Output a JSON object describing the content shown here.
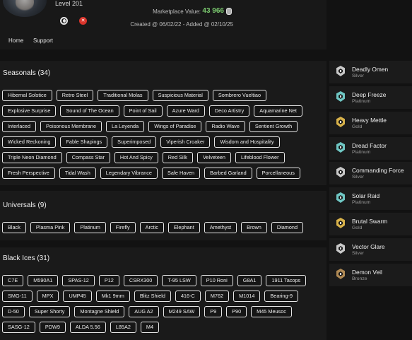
{
  "profile": {
    "level": "Level 201",
    "platform_icons": [
      "ubisoft-icon",
      "xbox-icon"
    ],
    "marketplace_label": "Marketplace Value:",
    "marketplace_value": "43 966",
    "dates": "Created @ 06/02/22 - Added @ 02/10/25"
  },
  "nav": {
    "home": "Home",
    "support": "Support"
  },
  "seasonals": {
    "title": "Seasonals (34)",
    "items": [
      "Hibernal Solstice",
      "Retro Steel",
      "Traditional Molas",
      "Suspicious Material",
      "Sombrero Vueltiao",
      "Explosive Surprise",
      "Sound of The Ocean",
      "Point of Sail",
      "Azure Ward",
      "Deco Artistry",
      "Aquamarine Net",
      "Interlaced",
      "Poisonous Membrane",
      "La Leyenda",
      "Wings of Paradise",
      "Radio Wave",
      "Sentient Growth",
      "Wicked Reckoning",
      "Fable Shapings",
      "Superimposed",
      "Viperish Croaker",
      "Wisdom and Hospitality",
      "Triple Neon Diamond",
      "Compass Star",
      "Hot And Spicy",
      "Red Silk",
      "Velveteen",
      "Lifeblood Flower",
      "Fresh Perspective",
      "Tidal Wash",
      "Legendary Vibrance",
      "Safe Haven",
      "Barbed Garland",
      "Porcellaneous"
    ]
  },
  "universals": {
    "title": "Universals (9)",
    "items": [
      "Black",
      "Plasma Pink",
      "Platinum",
      "Firefly",
      "Arctic",
      "Elephant",
      "Amethyst",
      "Brown",
      "Diamond"
    ]
  },
  "black_ices": {
    "title": "Black Ices (31)",
    "items": [
      "C7E",
      "M590A1",
      "SPAS-12",
      "P12",
      "CSRX300",
      "T-95 LSW",
      "P10 Roni",
      "G8A1",
      "1911 Tacops",
      "SMG-11",
      "MPX",
      "UMP45",
      "Mk1 9mm",
      "Blitz Shield",
      "416-C",
      "M762",
      "M1014",
      "Bearing-9",
      "D-50",
      "Super Shorty",
      "Montagne Shield",
      "AUG A2",
      "M249 SAW",
      "P9",
      "P90",
      "M45 Meusoc",
      "SASG-12",
      "PDW9",
      "ALDA 5.56",
      "L85A2",
      "M4"
    ]
  },
  "ranks": [
    {
      "name": "Deadly Omen",
      "tier": "Silver",
      "color": "#c9c9c9"
    },
    {
      "name": "Deep Freeze",
      "tier": "Platinum",
      "color": "#6fc7c4"
    },
    {
      "name": "Heavy Mettle",
      "tier": "Gold",
      "color": "#d8b24a"
    },
    {
      "name": "Dread Factor",
      "tier": "Platinum",
      "color": "#6fc7c4"
    },
    {
      "name": "Commanding Force",
      "tier": "Silver",
      "color": "#c9c9c9"
    },
    {
      "name": "Solar Raid",
      "tier": "Platinum",
      "color": "#6fc7c4"
    },
    {
      "name": "Brutal Swarm",
      "tier": "Gold",
      "color": "#d8b24a"
    },
    {
      "name": "Vector Glare",
      "tier": "Silver",
      "color": "#c9c9c9"
    },
    {
      "name": "Demon Veil",
      "tier": "Bronze",
      "color": "#b08a55"
    }
  ]
}
